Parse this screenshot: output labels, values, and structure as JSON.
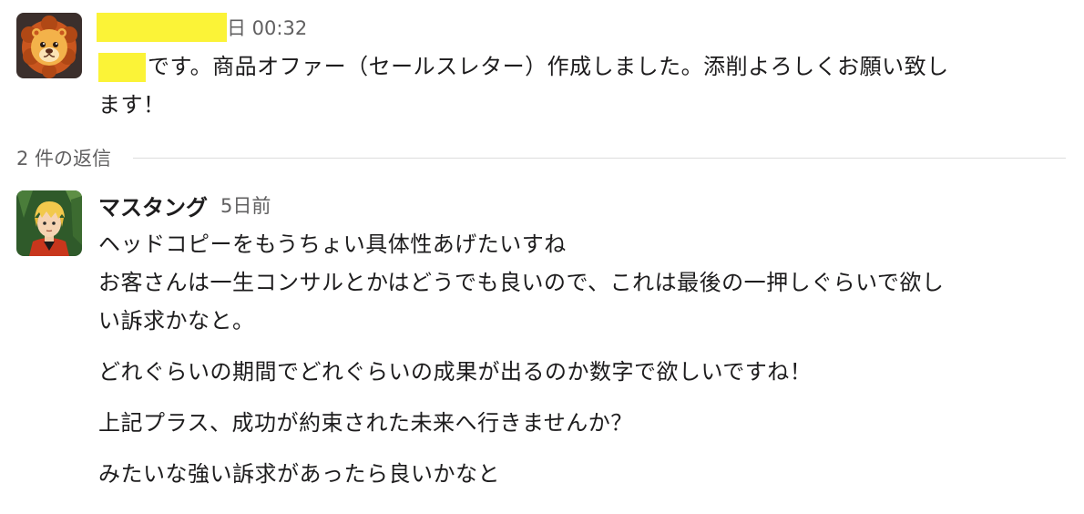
{
  "parent_message": {
    "avatar_icon": "lion-avatar-icon",
    "timestamp": "日 00:32",
    "lines": [
      "です。商品オファー（セールスレター）作成しました。添削よろしくお願い致し",
      "ます！"
    ]
  },
  "replies_divider": {
    "label": "2 件の返信"
  },
  "reply": {
    "avatar_icon": "blond-anime-character-avatar-icon",
    "username": "マスタング",
    "timestamp": "5日前",
    "lines": [
      "ヘッドコピーをもうちょい具体性あげたいすね",
      "お客さんは一生コンサルとかはどうでも良いので、これは最後の一押しぐらいで欲し",
      "い訴求かなと。",
      "どれぐらいの期間でどれぐらいの成果が出るのか数字で欲しいですね！",
      "上記プラス、成功が約束された未来へ行きませんか？",
      "みたいな強い訴求があったら良いかなと"
    ]
  },
  "colors": {
    "redaction": "#fbf337",
    "muted_text": "#616061",
    "divider": "#dddddd"
  }
}
